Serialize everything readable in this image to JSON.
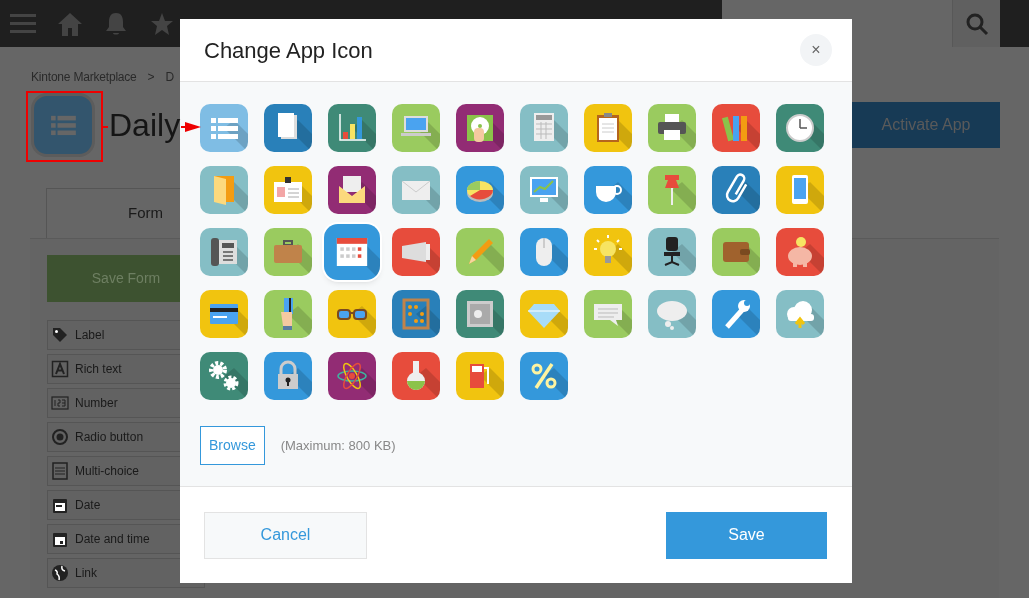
{
  "breadcrumb": [
    "Kintone Marketplace",
    ">",
    "D"
  ],
  "app": {
    "title": "Daily"
  },
  "activate_button": "Activate App",
  "tabs": [
    {
      "label": "Form"
    }
  ],
  "save_form_button": "Save Form",
  "fields": [
    {
      "label": "Label",
      "kind": "tag"
    },
    {
      "label": "Rich text",
      "kind": "richtext"
    },
    {
      "label": "Number",
      "kind": "number"
    },
    {
      "label": "Radio button",
      "kind": "radio"
    },
    {
      "label": "Multi-choice",
      "kind": "multichoice"
    },
    {
      "label": "Date",
      "kind": "date"
    },
    {
      "label": "Date and time",
      "kind": "datetime"
    },
    {
      "label": "Link",
      "kind": "link"
    }
  ],
  "dialog": {
    "title": "Change App Icon",
    "close": "×",
    "icons": [
      {
        "kind": "list",
        "color": "#7fbde4",
        "selected": false
      },
      {
        "kind": "document",
        "color": "#2980b9",
        "selected": false
      },
      {
        "kind": "chart",
        "color": "#3f8a77",
        "selected": false
      },
      {
        "kind": "laptop",
        "color": "#9acb5f",
        "selected": false
      },
      {
        "kind": "disc",
        "color": "#922c74",
        "selected": false
      },
      {
        "kind": "calculator",
        "color": "#85bec5",
        "selected": false
      },
      {
        "kind": "clipboard",
        "color": "#f1c40f",
        "selected": false
      },
      {
        "kind": "printer",
        "color": "#9acb5f",
        "selected": false
      },
      {
        "kind": "binders",
        "color": "#e74c3c",
        "selected": false
      },
      {
        "kind": "clock",
        "color": "#3f8a77",
        "selected": false
      },
      {
        "kind": "folder",
        "color": "#85bec5",
        "selected": false
      },
      {
        "kind": "badge",
        "color": "#f1c40f",
        "selected": false
      },
      {
        "kind": "letter",
        "color": "#922c74",
        "selected": false
      },
      {
        "kind": "envelope",
        "color": "#85bec5",
        "selected": false
      },
      {
        "kind": "pie",
        "color": "#3498db",
        "selected": false
      },
      {
        "kind": "monitor",
        "color": "#85bec5",
        "selected": false
      },
      {
        "kind": "cup",
        "color": "#3498db",
        "selected": false
      },
      {
        "kind": "pushpin",
        "color": "#9acb5f",
        "selected": false
      },
      {
        "kind": "paperclip",
        "color": "#2980b9",
        "selected": false
      },
      {
        "kind": "smartphone",
        "color": "#f1c40f",
        "selected": false
      },
      {
        "kind": "telephone",
        "color": "#85bec5",
        "selected": false
      },
      {
        "kind": "briefcase",
        "color": "#9acb5f",
        "selected": false
      },
      {
        "kind": "calendar",
        "color": "#3498db",
        "selected": true
      },
      {
        "kind": "megaphone",
        "color": "#e74c3c",
        "selected": false
      },
      {
        "kind": "pencil",
        "color": "#9acb5f",
        "selected": false
      },
      {
        "kind": "mouse",
        "color": "#3498db",
        "selected": false
      },
      {
        "kind": "lightbulb",
        "color": "#f1c40f",
        "selected": false
      },
      {
        "kind": "chair",
        "color": "#85bec5",
        "selected": false
      },
      {
        "kind": "wallet",
        "color": "#9acb5f",
        "selected": false
      },
      {
        "kind": "piggy-bank",
        "color": "#e74c3c",
        "selected": false
      },
      {
        "kind": "credit-card",
        "color": "#f1c40f",
        "selected": false
      },
      {
        "kind": "card-hand",
        "color": "#9acb5f",
        "selected": false
      },
      {
        "kind": "glasses",
        "color": "#f1c40f",
        "selected": false
      },
      {
        "kind": "abacus",
        "color": "#2980b9",
        "selected": false
      },
      {
        "kind": "safe",
        "color": "#3f8a77",
        "selected": false
      },
      {
        "kind": "diamond",
        "color": "#f1c40f",
        "selected": false
      },
      {
        "kind": "speech-bubble",
        "color": "#9acb5f",
        "selected": false
      },
      {
        "kind": "thought-bubble",
        "color": "#85bec5",
        "selected": false
      },
      {
        "kind": "wrench",
        "color": "#3498db",
        "selected": false
      },
      {
        "kind": "cloud-upload",
        "color": "#85bec5",
        "selected": false
      },
      {
        "kind": "gears",
        "color": "#3f8a77",
        "selected": false
      },
      {
        "kind": "padlock",
        "color": "#3498db",
        "selected": false
      },
      {
        "kind": "atom",
        "color": "#922c74",
        "selected": false
      },
      {
        "kind": "flask",
        "color": "#e74c3c",
        "selected": false
      },
      {
        "kind": "fuel-pump",
        "color": "#f1c40f",
        "selected": false
      },
      {
        "kind": "percent",
        "color": "#3498db",
        "selected": false
      }
    ],
    "browse_button": "Browse",
    "limit_note": "(Maximum: 800 KB)",
    "cancel_button": "Cancel",
    "save_button": "Save"
  }
}
